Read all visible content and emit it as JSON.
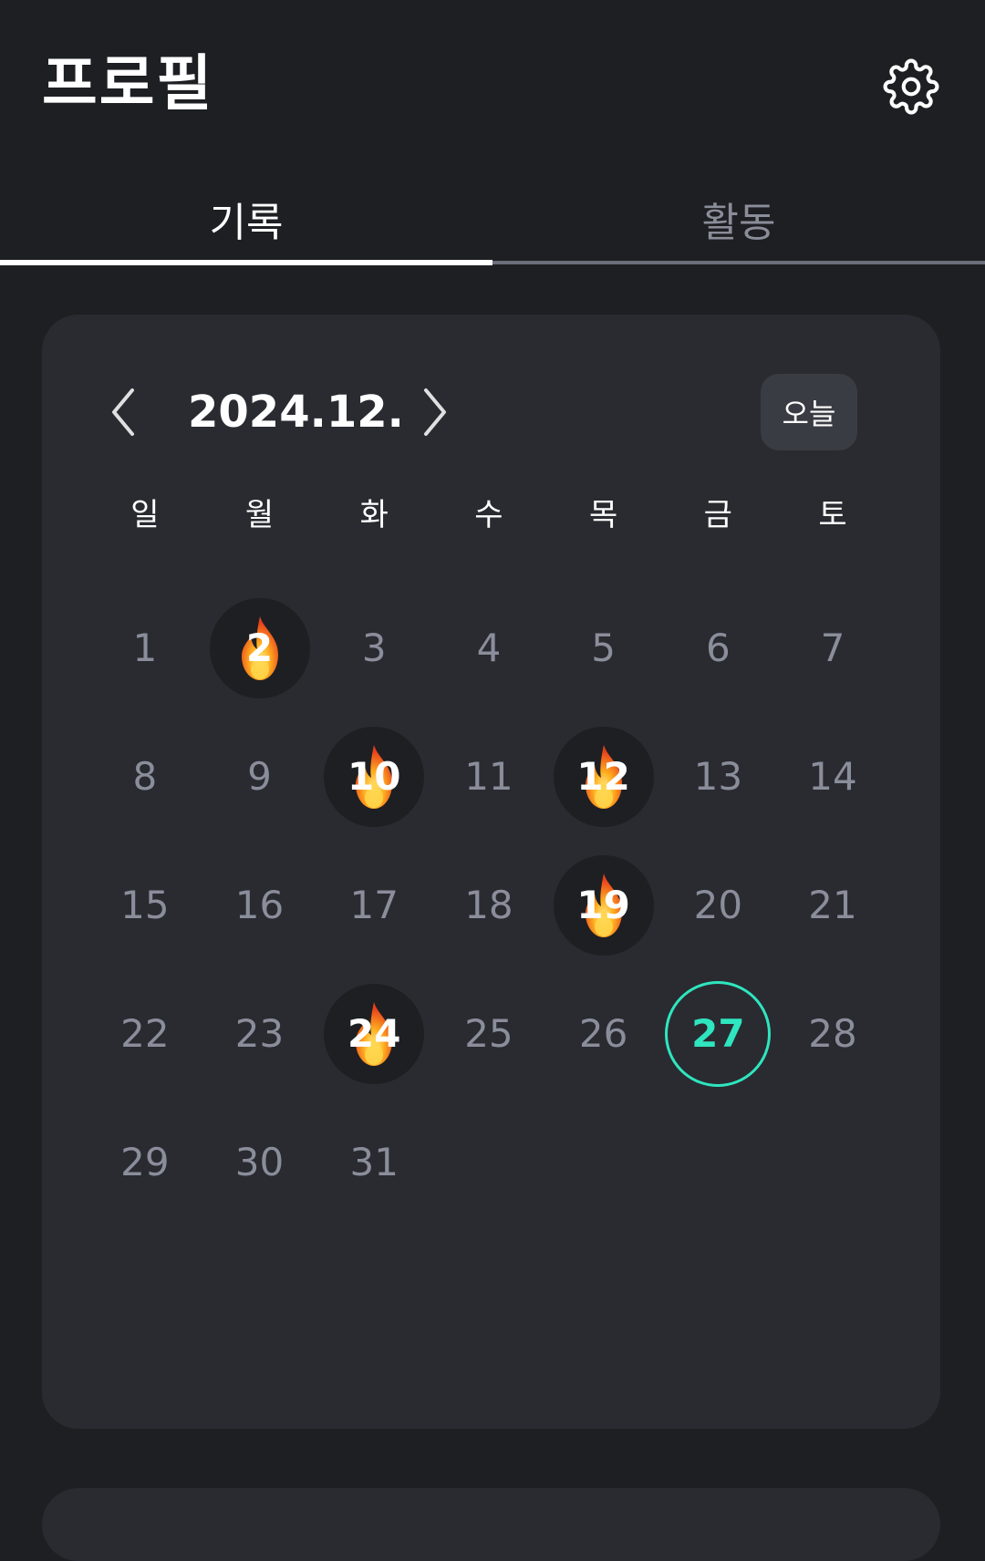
{
  "header": {
    "title": "프로필",
    "settings_icon": "gear-icon"
  },
  "tabs": [
    {
      "label": "기록",
      "active": true
    },
    {
      "label": "활동",
      "active": false
    }
  ],
  "calendar": {
    "month_label": "2024.12.",
    "prev_icon": "chevron-left-icon",
    "next_icon": "chevron-right-icon",
    "today_button": "오늘",
    "weekdays": [
      "일",
      "월",
      "화",
      "수",
      "목",
      "금",
      "토"
    ],
    "first_weekday_index": 0,
    "days_in_month": 31,
    "fire_days": [
      2,
      10,
      12,
      19,
      24
    ],
    "today": 27,
    "colors": {
      "card": "#2a2b31",
      "fire_bg": "#1e1f23",
      "today_accent": "#2ee6bf",
      "day_text": "#8a8e9b"
    }
  }
}
